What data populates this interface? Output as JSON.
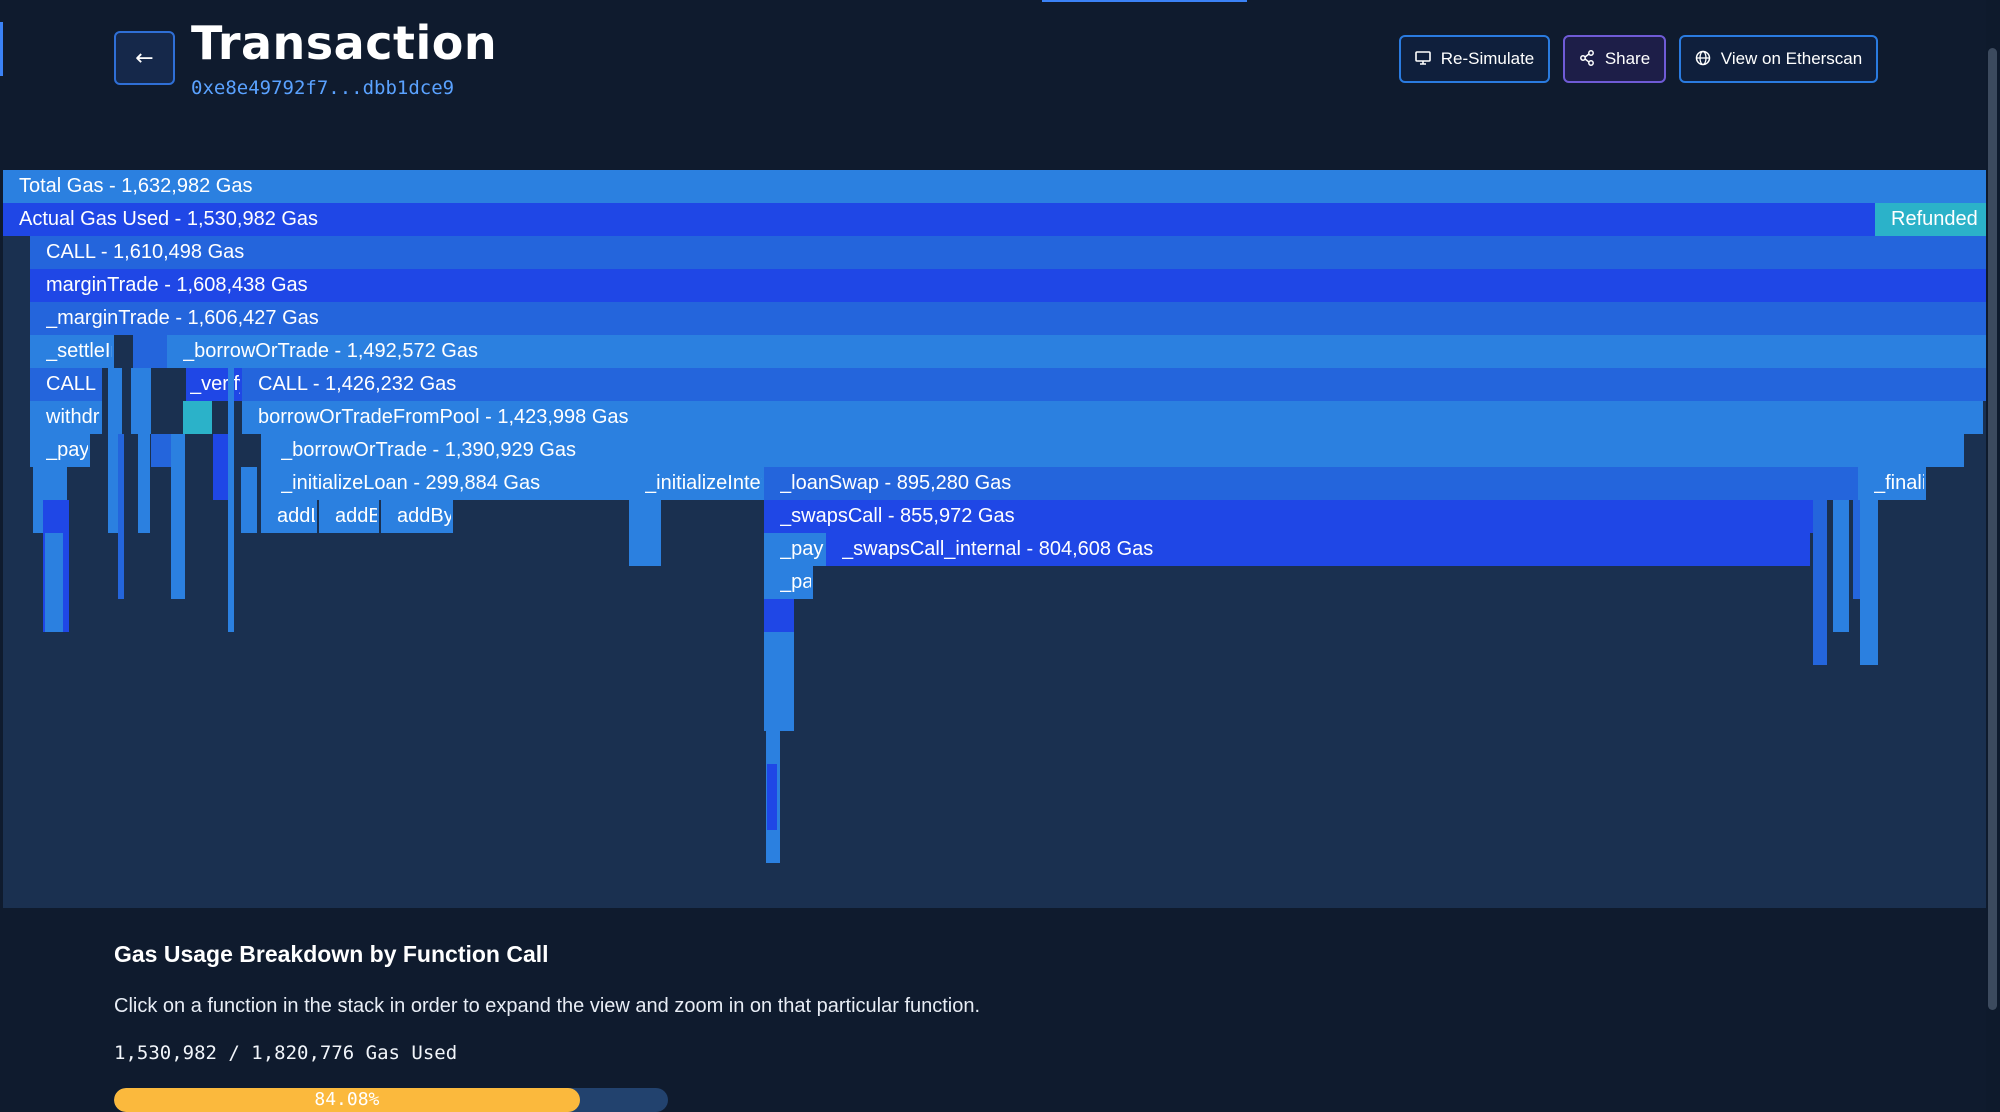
{
  "header": {
    "title": "Transaction",
    "hash": "0xe8e49792f7...dbb1dce9",
    "back_icon": "arrow-left-icon",
    "buttons": {
      "resimulate": {
        "label": "Re-Simulate",
        "icon": "monitor-icon"
      },
      "share": {
        "label": "Share",
        "icon": "share-icon"
      },
      "etherscan": {
        "label": "View on Etherscan",
        "icon": "globe-icon"
      }
    }
  },
  "flamegraph": {
    "total_gas": "Total Gas - 1,632,982 Gas",
    "actual_gas": "Actual Gas Used - 1,530,982 Gas",
    "refunded": "Refunded",
    "labels": {
      "call1": "CALL - 1,610,498 Gas",
      "margin_trade": "marginTrade - 1,608,438 Gas",
      "margin_trade_internal": "_marginTrade - 1,606,427 Gas",
      "settle": "_settleInterest",
      "borrow_or_trade": "_borrowOrTrade - 1,492,572 Gas",
      "call_small": "CALL",
      "verify": "_verify",
      "call2": "CALL - 1,426,232 Gas",
      "withdraw": "withdraw",
      "borrow_from_pool": "borrowOrTradeFromPool - 1,423,998 Gas",
      "pay": "_payInterest",
      "borrow_or_trade_internal": "_borrowOrTrade - 1,390,929 Gas",
      "initialize_loan": "_initializeLoan - 299,884 Gas",
      "initialize_interest": "_initializeInterest",
      "loan_swap": "_loanSwap - 895,280 Gas",
      "finalize": "_finalizeOpen",
      "add_a": "addLoan",
      "add_b": "addBorrower",
      "add_c": "addByToken",
      "swaps_call": "_swapsCall - 855,972 Gas",
      "pay_swap": "_payFee",
      "swaps_call_internal": "_swapsCall_internal - 804,608 Gas",
      "pay_swap2": "_payFee"
    },
    "colors": {
      "level_light": "#2b80e0",
      "level_blue": "#1f47e6",
      "level_mid": "#2465dc",
      "refund": "#2bb2c9",
      "background": "#1a3050"
    }
  },
  "breakdown": {
    "title": "Gas Usage Breakdown by Function Call",
    "description": "Click on a function in the stack in order to expand the view and zoom in on that particular function.",
    "used_text": "1,530,982 / 1,820,776 Gas Used",
    "percent_label": "84.08%",
    "percent_value": 84.08
  }
}
